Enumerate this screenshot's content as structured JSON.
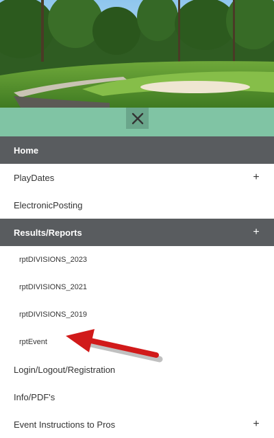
{
  "header": {
    "image_alt": "golf-course-banner"
  },
  "close_button": {
    "icon": "close-icon"
  },
  "menu": {
    "items": [
      {
        "label": "Home",
        "expandable": false,
        "active": true
      },
      {
        "label": "PlayDates",
        "expandable": true,
        "active": false
      },
      {
        "label": "ElectronicPosting",
        "expandable": false,
        "active": false
      },
      {
        "label": "Results/Reports",
        "expandable": true,
        "active": true
      },
      {
        "label": "Login/Logout/Registration",
        "expandable": false,
        "active": false
      },
      {
        "label": "Info/PDF's",
        "expandable": false,
        "active": false
      },
      {
        "label": "Event Instructions to Pros",
        "expandable": true,
        "active": false
      }
    ],
    "subitems": [
      {
        "label": "rptDIVISIONS_2023"
      },
      {
        "label": "rptDIVISIONS_2021"
      },
      {
        "label": "rptDIVISIONS_2019"
      },
      {
        "label": "rptEvent"
      }
    ],
    "expand_glyph": "+"
  },
  "colors": {
    "accent": "#80c4a4",
    "active_bg": "#595c5f",
    "arrow": "#d11a1a"
  }
}
